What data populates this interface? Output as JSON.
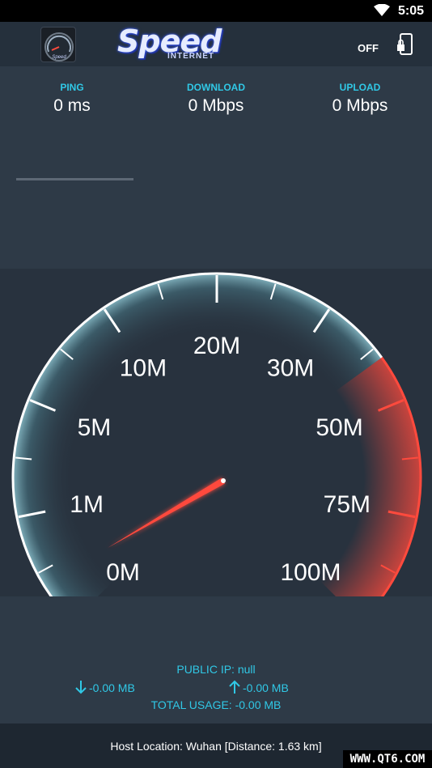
{
  "status_bar": {
    "time": "5:05"
  },
  "app_bar": {
    "logo_word": "Speed",
    "logo_sub": "INTERNET",
    "toggle_label": "OFF"
  },
  "stats": {
    "ping": {
      "label": "PING",
      "value": "0 ms"
    },
    "download": {
      "label": "DOWNLOAD",
      "value": "0 Mbps"
    },
    "upload": {
      "label": "UPLOAD",
      "value": "0 Mbps"
    },
    "progress": 0
  },
  "gauge": {
    "labels": [
      {
        "text": "0M",
        "value": 0
      },
      {
        "text": "1M",
        "value": 1
      },
      {
        "text": "5M",
        "value": 5
      },
      {
        "text": "10M",
        "value": 10
      },
      {
        "text": "20M",
        "value": 20
      },
      {
        "text": "30M",
        "value": 30
      },
      {
        "text": "50M",
        "value": 50
      },
      {
        "text": "75M",
        "value": 75
      },
      {
        "text": "100M",
        "value": 100
      }
    ],
    "needle_value": 0,
    "accent_color": "#ff4a3d",
    "scale_color": "#ffffff"
  },
  "info": {
    "public_ip": "PUBLIC IP: null",
    "download_usage": "-0.00 MB",
    "upload_usage": "-0.00 MB",
    "total_usage": "TOTAL USAGE: -0.00 MB"
  },
  "footer": {
    "host_location": "Host Location: Wuhan [Distance: 1.63 km]"
  },
  "watermark": "WWW.QT6.COM"
}
